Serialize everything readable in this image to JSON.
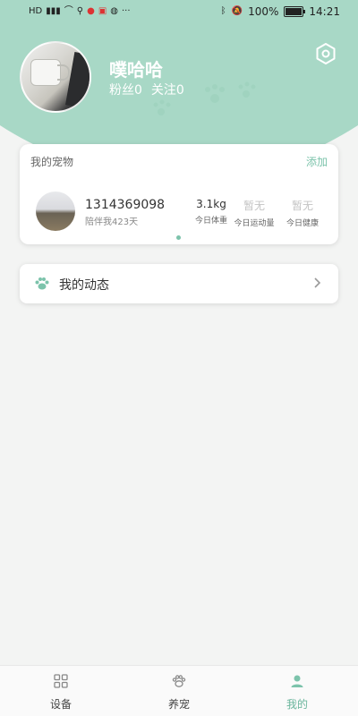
{
  "status_bar": {
    "left_icons": [
      "hd-icon",
      "signal-icon",
      "wifi-icon",
      "usb-icon",
      "weibo-icon",
      "app-icon",
      "chat-icon",
      "more-icon"
    ],
    "bluetooth": "bluetooth-icon",
    "mute": "mute-icon",
    "battery_percent": "100%",
    "battery_level": 1.0,
    "time": "14:21"
  },
  "profile": {
    "username": "噗哈哈",
    "fans_label": "粉丝0",
    "following_label": "关注0"
  },
  "pet_card": {
    "title": "我的宠物",
    "add_label": "添加",
    "pet": {
      "name": "1314369098",
      "days": "陪伴我423天"
    },
    "stats": [
      {
        "value": "3.1kg",
        "label": "今日体重",
        "muted": false
      },
      {
        "value": "暂无",
        "label": "今日运动量",
        "muted": true
      },
      {
        "value": "暂无",
        "label": "今日健康",
        "muted": true
      }
    ]
  },
  "activity": {
    "label": "我的动态"
  },
  "bottom_nav": {
    "items": [
      {
        "label": "设备",
        "icon": "grid-icon",
        "active": false
      },
      {
        "label": "养宠",
        "icon": "paw-icon",
        "active": false
      },
      {
        "label": "我的",
        "icon": "person-icon",
        "active": true
      }
    ]
  },
  "colors": {
    "accent": "#7cc3ab",
    "header_bg": "#a8d8c6",
    "page_bg": "#f3f4f3"
  }
}
